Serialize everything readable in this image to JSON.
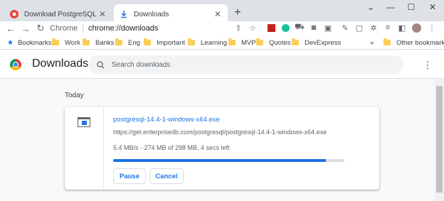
{
  "tabs": [
    {
      "title": "Download PostgreSQL",
      "active": false
    },
    {
      "title": "Downloads",
      "active": true
    }
  ],
  "omnibox": {
    "site": "Chrome",
    "url": "chrome://downloads"
  },
  "bookmarks": {
    "main": "Bookmarks",
    "folders": [
      "Work",
      "Banks",
      "Eng",
      "Important",
      "Learning",
      "MVP",
      "Quotes",
      "DevExpress"
    ],
    "overflow": "»",
    "other": "Other bookmarks"
  },
  "downloads_page": {
    "title": "Downloads",
    "search_placeholder": "Search downloads",
    "section": "Today"
  },
  "download": {
    "filename": "postgresql-14.4-1-windows-x64.exe",
    "url": "https://get.enterprisedb.com/postgresql/postgresql-14.4-1-windows-x64.exe",
    "status": "5.4 MB/s - 274 MB of 298 MB, 4 secs left",
    "progress_fraction": 0.92,
    "pause_label": "Pause",
    "cancel_label": "Cancel"
  },
  "colors": {
    "accent": "#1a73e8",
    "tabstrip": "#dee1e6"
  }
}
